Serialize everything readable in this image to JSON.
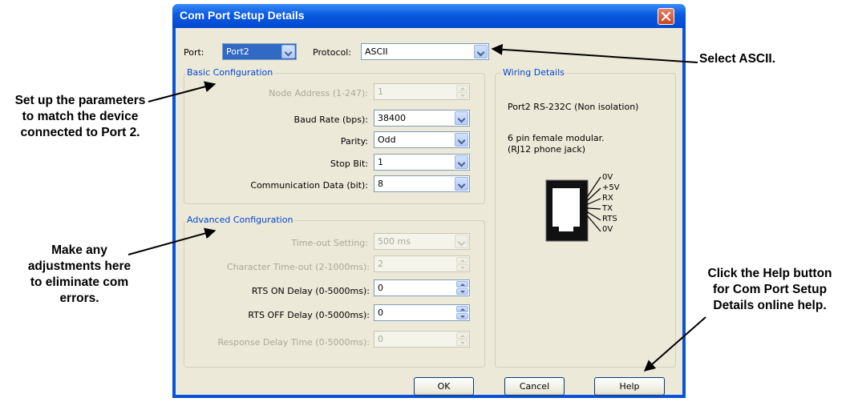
{
  "window": {
    "title": "Com Port Setup Details"
  },
  "port": {
    "label": "Port:",
    "value": "Port2"
  },
  "protocol": {
    "label": "Protocol:",
    "value": "ASCII"
  },
  "basic": {
    "title": "Basic Configuration",
    "node_address": {
      "label": "Node Address (1-247):",
      "value": "1"
    },
    "baud_rate": {
      "label": "Baud Rate (bps):",
      "value": "38400"
    },
    "parity": {
      "label": "Parity:",
      "value": "Odd"
    },
    "stop_bit": {
      "label": "Stop Bit:",
      "value": "1"
    },
    "comm_data": {
      "label": "Communication Data (bit):",
      "value": "8"
    }
  },
  "advanced": {
    "title": "Advanced Configuration",
    "timeout": {
      "label": "Time-out Setting:",
      "value": "500 ms"
    },
    "char_timeout": {
      "label": "Character Time-out (2-1000ms):",
      "value": "2"
    },
    "rts_on": {
      "label": "RTS ON Delay (0-5000ms):",
      "value": "0"
    },
    "rts_off": {
      "label": "RTS OFF Delay (0-5000ms):",
      "value": "0"
    },
    "response_delay": {
      "label": "Response Delay Time (0-5000ms):",
      "value": "0"
    }
  },
  "wiring": {
    "title": "Wiring Details",
    "port_line": "Port2 RS-232C (Non isolation)",
    "desc_line1": "6 pin female modular.",
    "desc_line2": "(RJ12 phone jack)",
    "pins": [
      "0V",
      "+5V",
      "RX",
      "TX",
      "RTS",
      "0V"
    ]
  },
  "buttons": {
    "ok": "OK",
    "cancel": "Cancel",
    "help": "Help"
  },
  "callouts": {
    "select_ascii": "Select ASCII.",
    "set_params": "Set up the parameters\nto match the device\nconnected to Port 2.",
    "adjustments": "Make any\nadjustments here\nto eliminate com\nerrors.",
    "help": "Click the Help button\nfor Com Port Setup\nDetails online help."
  },
  "colors": {
    "titlebar": "#0a5ae0",
    "dialog_bg": "#ece9d8",
    "group_title": "#0046d5",
    "selection": "#316ac5"
  }
}
